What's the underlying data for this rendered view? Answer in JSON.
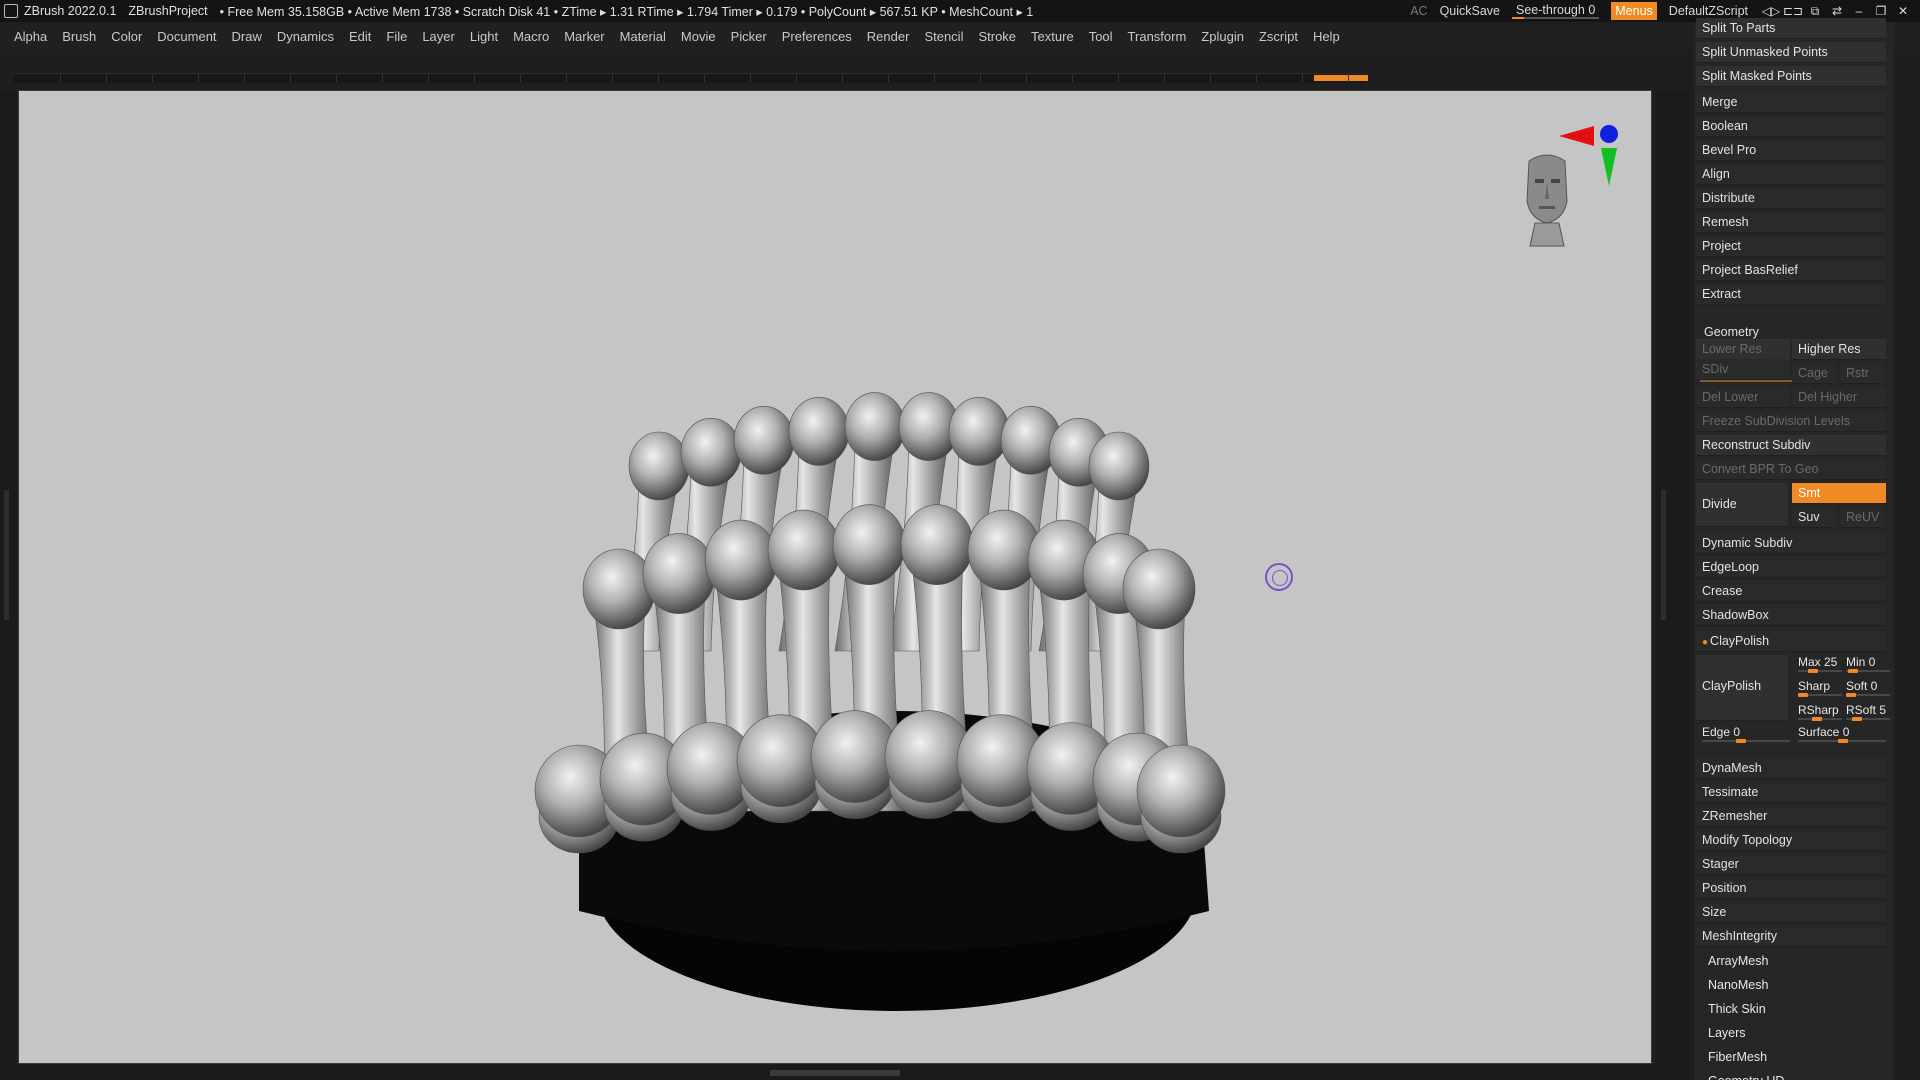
{
  "titlebar": {
    "app": "ZBrush 2022.0.1",
    "project": "ZBrushProject",
    "stats": "• Free Mem 35.158GB • Active Mem 1738 • Scratch Disk 41 •  ZTime ▸ 1.31 RTime ▸ 1.794 Timer ▸ 0.179 • PolyCount ▸ 567.51 KP  • MeshCount ▸ 1",
    "ac": "AC",
    "quicksave": "QuickSave",
    "see_through_label": "See-through",
    "see_through_value": "0",
    "menus": "Menus",
    "script": "DefaultZScript"
  },
  "menubar": {
    "items": [
      "Alpha",
      "Brush",
      "Color",
      "Document",
      "Draw",
      "Dynamics",
      "Edit",
      "File",
      "Layer",
      "Light",
      "Macro",
      "Marker",
      "Material",
      "Movie",
      "Picker",
      "Preferences",
      "Render",
      "Stencil",
      "Stroke",
      "Texture",
      "Tool",
      "Transform",
      "Zplugin",
      "Zscript",
      "Help"
    ]
  },
  "subtool": {
    "items": [
      "Split To Parts",
      "Split Unmasked Points",
      "Split Masked Points",
      "Merge",
      "Boolean",
      "Bevel Pro",
      "Align",
      "Distribute",
      "Remesh",
      "Project",
      "Project BasRelief",
      "Extract"
    ]
  },
  "geometry": {
    "title": "Geometry",
    "lower_res": "Lower Res",
    "higher_res": "Higher Res",
    "sdiv": "SDiv",
    "cage": "Cage",
    "rstr": "Rstr",
    "del_lower": "Del Lower",
    "del_higher": "Del Higher",
    "freeze": "Freeze SubDivision Levels",
    "reconstruct": "Reconstruct Subdiv",
    "convert_bpr": "Convert BPR To Geo",
    "divide": "Divide",
    "smt": "Smt",
    "suv": "Suv",
    "reuv": "ReUV",
    "items_a": [
      "Dynamic Subdiv",
      "EdgeLoop",
      "Crease",
      "ShadowBox"
    ],
    "claypolish_header": "ClayPolish",
    "claypolish_button": "ClayPolish",
    "max": "Max 25",
    "min": "Min 0",
    "sharp": "Sharp",
    "soft": "Soft 0",
    "rsharp": "RSharp",
    "rsoft": "RSoft 5",
    "edge": "Edge 0",
    "surface": "Surface 0",
    "items_b": [
      "DynaMesh",
      "Tessimate",
      "ZRemesher",
      "Modify Topology",
      "Stager",
      "Position",
      "Size",
      "MeshIntegrity"
    ]
  },
  "more": {
    "items": [
      "ArrayMesh",
      "NanoMesh",
      "Thick Skin",
      "Layers",
      "FiberMesh"
    ],
    "cut_off_item": "Geometry HD"
  },
  "colors": {
    "accent": "#f08a24",
    "canvas_bg": "#c5c5c5",
    "panel_bg": "#262626"
  }
}
